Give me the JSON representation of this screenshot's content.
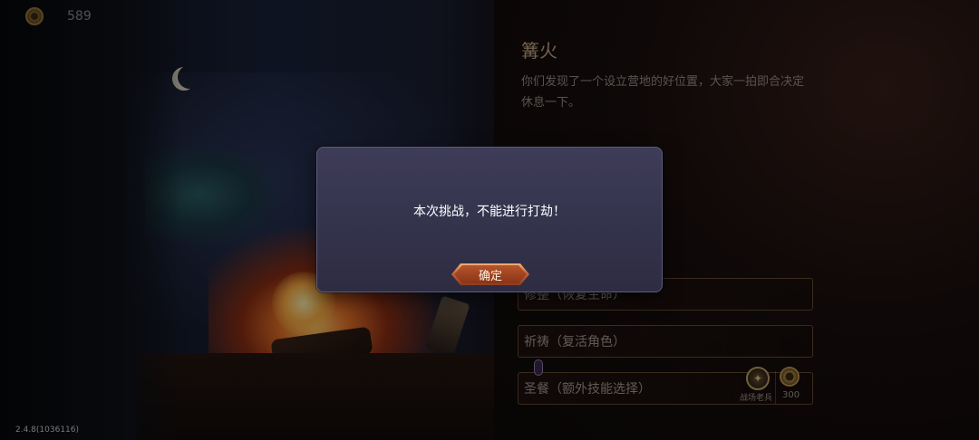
{
  "currency": {
    "icon": "coin-icon",
    "amount": "589"
  },
  "event": {
    "title": "篝火",
    "description": "你们发现了一个设立营地的好位置，大家一拍即合决定休息一下。"
  },
  "options": [
    {
      "label": "修整（恢复生命）"
    },
    {
      "label": "祈祷（复活角色）"
    },
    {
      "label": "圣餐（额外技能选择）",
      "skill_name": "战场老兵",
      "cost": "300",
      "cost_icon": "coin-icon"
    }
  ],
  "version": "2.4.8(1036116)",
  "dialog": {
    "message": "本次挑战，不能进行打劫！",
    "confirm_label": "确定"
  },
  "colors": {
    "modal_bg": "#3a3954",
    "button_accent": "#c8663a",
    "title_color": "#c4a887"
  }
}
